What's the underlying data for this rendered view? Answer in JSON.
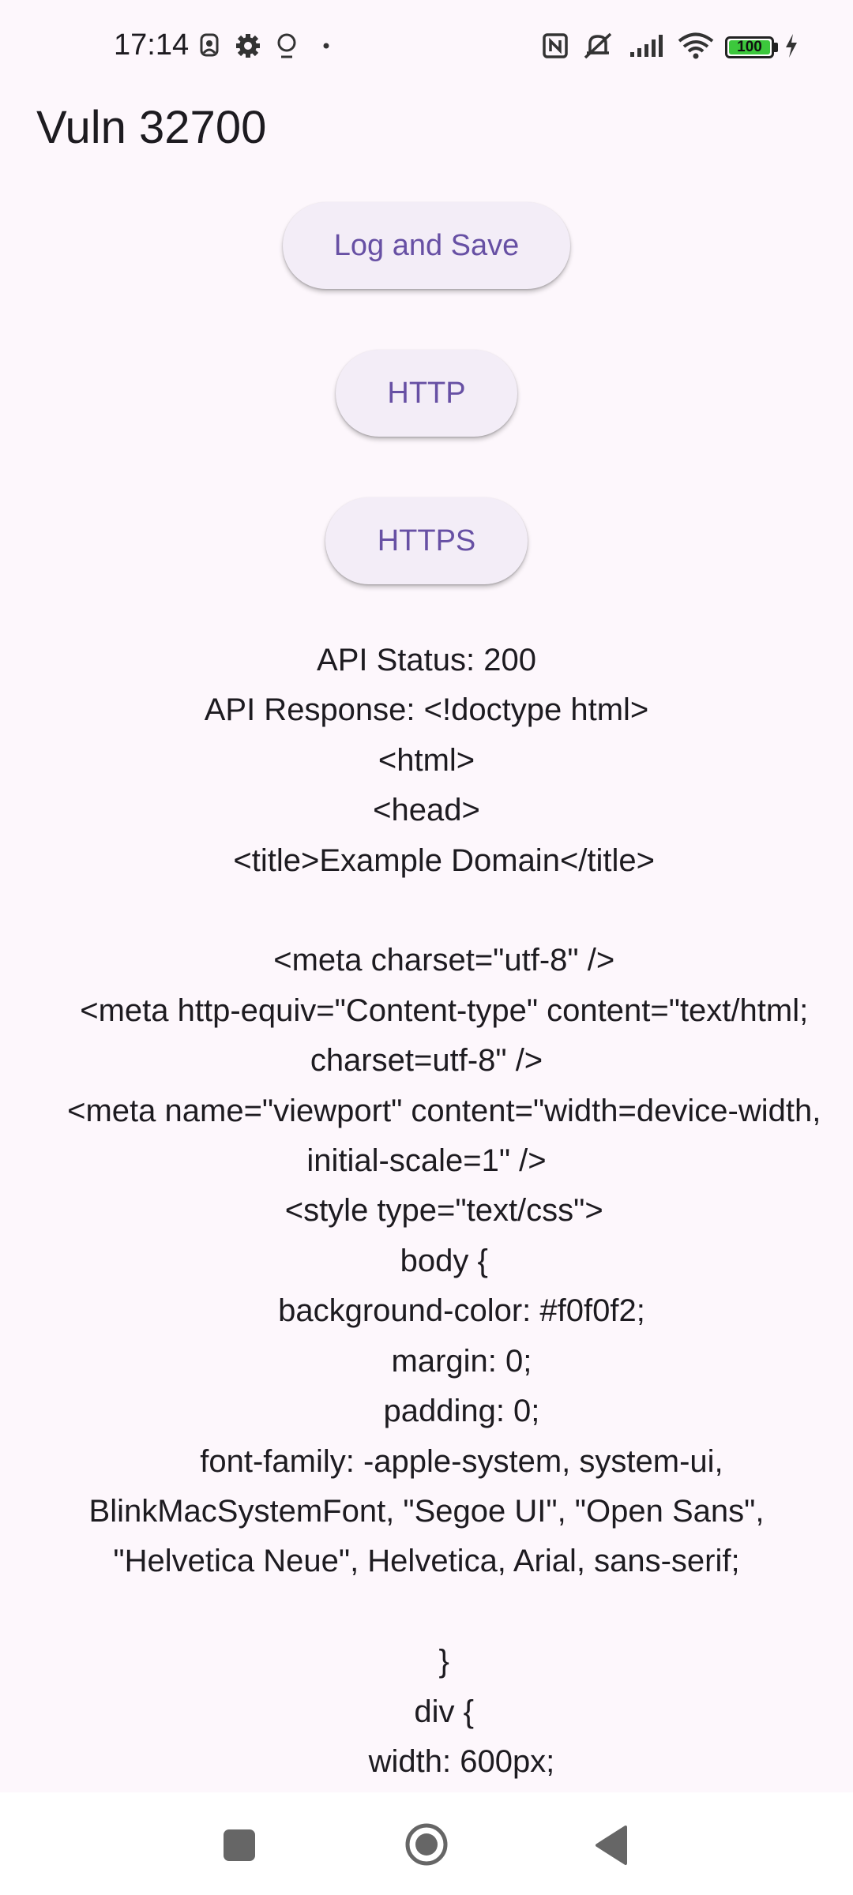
{
  "status_bar": {
    "time": "17:14",
    "battery": "100",
    "icons": [
      "profile-badge-icon",
      "settings-icon",
      "pin-icon",
      "dot-icon",
      "nfc-icon",
      "mute-icon",
      "signal-icon",
      "wifi-icon",
      "battery-icon",
      "charging-icon"
    ]
  },
  "app": {
    "title": "Vuln 32700"
  },
  "buttons": {
    "log_save": "Log and Save",
    "http": "HTTP",
    "https": "HTTPS"
  },
  "response": {
    "text": "API Status: 200\nAPI Response: <!doctype html>\n<html>\n<head>\n    <title>Example Domain</title>\n\n    <meta charset=\"utf-8\" />\n    <meta http-equiv=\"Content-type\" content=\"text/html; charset=utf-8\" />\n    <meta name=\"viewport\" content=\"width=device-width, initial-scale=1\" />\n    <style type=\"text/css\">\n    body {\n        background-color: #f0f0f2;\n        margin: 0;\n        padding: 0;\n        font-family: -apple-system, system-ui, BlinkMacSystemFont, \"Segoe UI\", \"Open Sans\", \"Helvetica Neue\", Helvetica, Arial, sans-serif;\n        \n    }\n    div {\n        width: 600px;"
  },
  "colors": {
    "background": "#fdf7fc",
    "button_bg": "#f3edf7",
    "button_text": "#6750a4",
    "text": "#1d1b20"
  }
}
